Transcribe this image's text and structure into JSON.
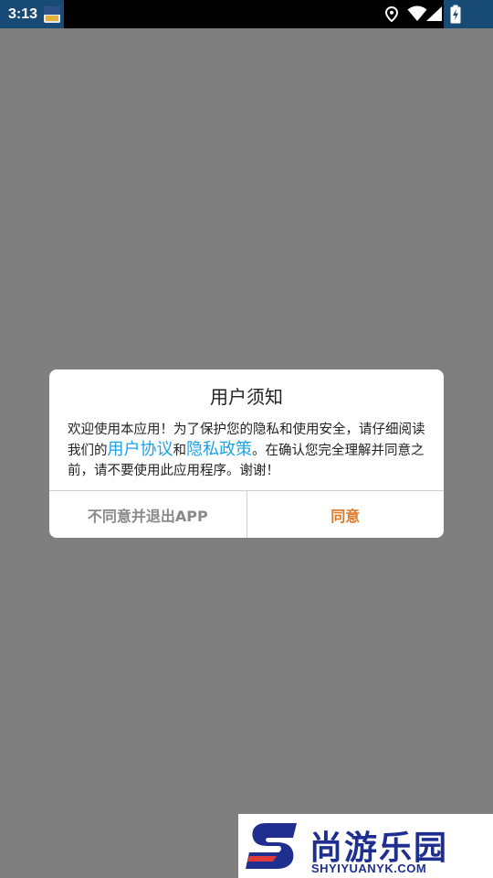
{
  "status_bar": {
    "time": "3:13",
    "icons": [
      "app-notification-icon",
      "location-icon",
      "wifi-icon",
      "signal-icon",
      "battery-charging-icon"
    ]
  },
  "dialog": {
    "title": "用户须知",
    "body_part1": "欢迎使用本应用！为了保护您的隐私和使用安全，请仔细阅读我们的",
    "link_user_agreement": "用户协议",
    "body_and": "和",
    "link_privacy_policy": "隐私政策",
    "body_part2": "。在确认您完全理解并同意之前，请不要使用此应用程序。谢谢！",
    "decline_label": "不同意并退出APP",
    "agree_label": "同意"
  },
  "watermark": {
    "name": "尚游乐园",
    "url": "SHYIYUANYK.COM"
  },
  "colors": {
    "overlay": "#7f7f7f",
    "status_accent": "#174a74",
    "link": "#1aa3e8",
    "agree": "#e07a2e",
    "decline": "#8a8a8a",
    "watermark": "#1f2f8f"
  }
}
